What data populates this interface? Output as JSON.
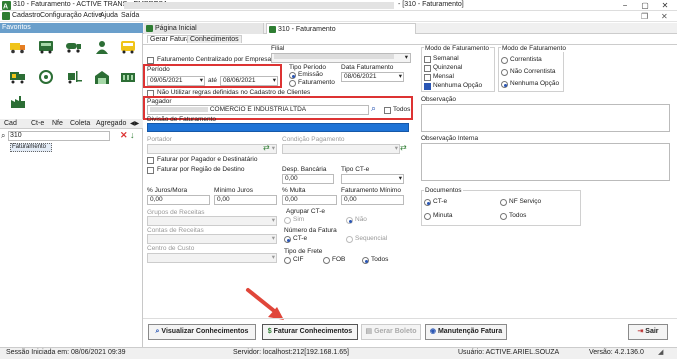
{
  "window": {
    "title": "310 - Faturamento - ACTIVE TRANS - EMPRESA:",
    "title_suffix": "- [310 - Faturamento]"
  },
  "menu": {
    "items": [
      "Cadastro",
      "Configuração Active",
      "Ajuda",
      "Saída"
    ]
  },
  "sidebar": {
    "favorites_label": "Favoritos",
    "tabs": [
      "Cad",
      "Ct-e",
      "Nfe",
      "Coleta",
      "Agregado"
    ],
    "search_value": "310",
    "result": "Faturamento"
  },
  "doc_tabs": {
    "home": "Página Inicial",
    "billing": "310 - Faturamento"
  },
  "sub_tabs": {
    "generate": "Gerar Fatura",
    "receipts": "Conhecimentos"
  },
  "form": {
    "filial_label": "Filial",
    "centralized_label": "Faturamento Centralizado por Empresa",
    "periodo_label": "Período",
    "date_from": "09/05/2021",
    "ate_label": "até",
    "date_to": "08/06/2021",
    "tipo_periodo_label": "Tipo Período",
    "tipo_periodo_options": [
      "Emissão",
      "Faturamento"
    ],
    "data_fat_label": "Data Faturamento",
    "data_fat_value": "08/06/2021",
    "no_rules_label": "Não Utilizar regras definidas no Cadastro de Clientes",
    "pagador_label": "Pagador",
    "pagador_value": "COMERCIO E INDUSTRIA LTDA",
    "todos_label": "Todos",
    "divisao_label": "Divisão de Faturamento",
    "portador_label": "Portador",
    "condicao_label": "Condição Pagamento",
    "fat_pagador_dest_label": "Faturar por Pagador e Destinatário",
    "fat_regiao_label": "Faturar por Região de Destino",
    "desp_bancaria_label": "Desp. Bancária",
    "desp_bancaria_value": "0,00",
    "tipo_cte_label": "Tipo CT-e",
    "juros_label": "% Juros/Mora",
    "juros_value": "0,00",
    "min_juros_label": "Mínimo Juros",
    "min_juros_value": "0,00",
    "multa_label": "% Multa",
    "multa_value": "0,00",
    "fat_min_label": "Faturamento Mínimo",
    "fat_min_value": "0,00",
    "grupos_label": "Grupos de Receitas",
    "agrupar_label": "Agrupar CT-e",
    "agrupar_options": [
      "Sim",
      "Não"
    ],
    "contas_label": "Contas de Receitas",
    "num_fatura_label": "Número da Fatura",
    "num_fatura_options": [
      "CT-e",
      "Sequencial"
    ],
    "centro_label": "Centro de Custo",
    "tipo_frete_label": "Tipo de Frete",
    "tipo_frete_options": [
      "CIF",
      "FOB",
      "Todos"
    ]
  },
  "right_panel": {
    "modo1_label": "Modo de Faturamento",
    "modo1_options": [
      "Semanal",
      "Quinzenal",
      "Mensal",
      "Nenhuma Opção"
    ],
    "modo2_label": "Modo de Faturamento",
    "modo2_options": [
      "Correntista",
      "Não Correntista",
      "Nenhuma Opção"
    ],
    "obs_label": "Observação",
    "obs_interna_label": "Observação Interna",
    "docs_label": "Documentos",
    "docs_options": [
      "CT-e",
      "NF Serviço",
      "Minuta",
      "Todos"
    ]
  },
  "buttons": {
    "visualizar": "Visualizar Conhecimentos",
    "faturar": "Faturar Conhecimentos",
    "gerar_boleto": "Gerar Boleto",
    "manutencao": "Manutenção Fatura",
    "sair": "Sair"
  },
  "status": {
    "session": "Sessão Iniciada em: 08/06/2021 09:39",
    "server": "Servidor: localhost:212[192.168.1.65]",
    "user": "Usuário: ACTIVE.ARIEL.SOUZA",
    "version": "Versão: 4.2.136.0"
  },
  "colors": {
    "accent": "#2a56b4",
    "highlight_red": "#d33333",
    "favorites_header": "#6a9fcb",
    "progress_blue": "#1e73d6",
    "arrow_red": "#e0463a"
  }
}
